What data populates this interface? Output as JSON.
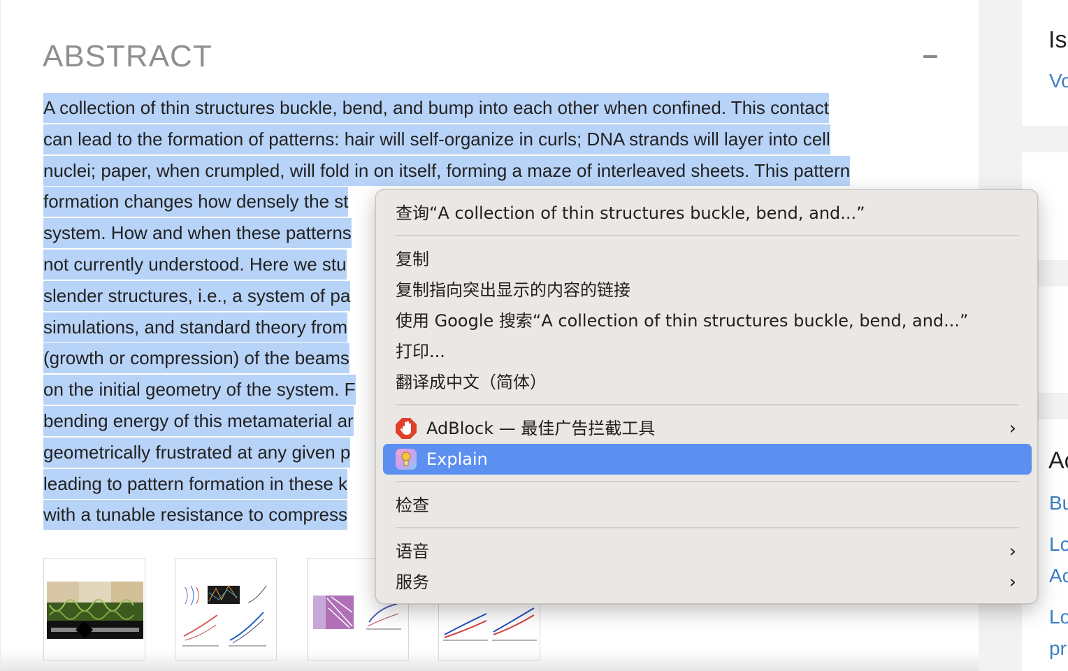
{
  "abstract": {
    "title": "ABSTRACT",
    "lines": [
      "A collection of thin structures buckle, bend, and bump into each other when confined. This contact",
      "can lead to the formation of patterns: hair will self-organize in curls; DNA strands will layer into cell",
      "nuclei; paper, when crumpled, will fold in on itself, forming a maze of interleaved sheets. This pattern",
      "formation changes how densely the st",
      "system. How and when these patterns",
      "not currently understood. Here we stu",
      "slender structures, i.e., a system of pa",
      "simulations, and standard theory from",
      "(growth or compression) of the beams",
      "on the initial geometry of the system. F",
      "bending energy of this metamaterial ar",
      "geometrically frustrated at any given p",
      "leading to pattern formation in these k",
      "with a tunable resistance to compress"
    ]
  },
  "thumbnails": [
    {
      "alt": "figure-1"
    },
    {
      "alt": "figure-2"
    },
    {
      "alt": "figure-3"
    },
    {
      "alt": "figure-4"
    }
  ],
  "sidebar": {
    "heading_top": "Is",
    "link_top": "Vo",
    "heading_mid": "Ac",
    "links": [
      "Bu",
      "Lo",
      "Ac",
      "Lo",
      "pr"
    ]
  },
  "context_menu": {
    "lookup": "查询“A collection of thin structures buckle, bend, and...”",
    "copy": "复制",
    "copy_link": "复制指向突出显示的内容的链接",
    "google_search": "使用 Google 搜索“A collection of thin structures buckle, bend, and...”",
    "print": "打印...",
    "translate": "翻译成中文（简体）",
    "adblock": "AdBlock — 最佳广告拦截工具",
    "explain": "Explain",
    "inspect": "检查",
    "speech": "语音",
    "services": "服务",
    "submenu_chevron": "›",
    "highlight_color": "#5b8ff0",
    "adblock_icon": "adblock-hand-icon",
    "explain_icon": "explain-app-icon"
  }
}
